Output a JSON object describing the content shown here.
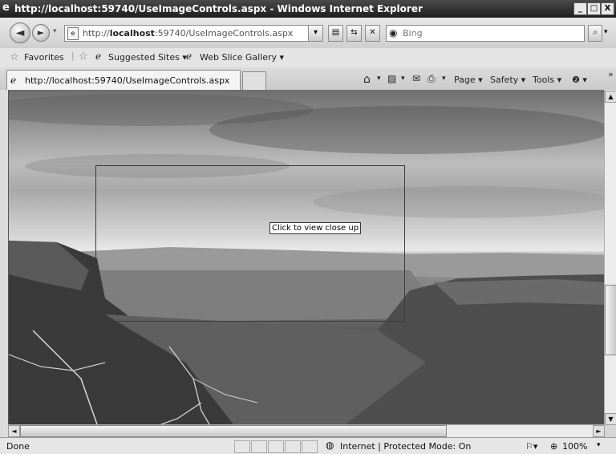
{
  "window": {
    "title": "http://localhost:59740/UseImageControls.aspx - Windows Internet Explorer",
    "logo_glyph": "e",
    "minimize": "_",
    "restore": "□",
    "close": "X"
  },
  "address_bar": {
    "url_prefix": "http://",
    "url_host": "localhost",
    "url_rest": ":59740/UseImageControls.aspx",
    "back_glyph": "◄",
    "forward_glyph": "►"
  },
  "search": {
    "placeholder": "Bing",
    "search_glyph": "⌕"
  },
  "favorites_bar": {
    "favorites": "Favorites",
    "suggested_sites": "Suggested Sites ▾",
    "web_slice_gallery": "Web Slice Gallery ▾"
  },
  "tab": {
    "title": "http://localhost:59740/UseImageControls.aspx"
  },
  "command_bar": {
    "page": "Page ▾",
    "safety": "Safety ▾",
    "tools": "Tools ▾",
    "help": "❷ ▾",
    "more": "»"
  },
  "content": {
    "tooltip": "Click to view close up"
  },
  "status_bar": {
    "status": "Done",
    "zone": "Internet | Protected Mode: On",
    "zoom": "100%"
  },
  "icons": [
    "ie-logo-icon",
    "back-icon",
    "forward-icon",
    "page-icon",
    "refresh-icon",
    "stop-icon",
    "bing-icon",
    "search-icon",
    "favorites-star-icon",
    "home-icon",
    "rss-icon",
    "mail-icon",
    "print-icon",
    "globe-icon",
    "zoom-icon"
  ]
}
